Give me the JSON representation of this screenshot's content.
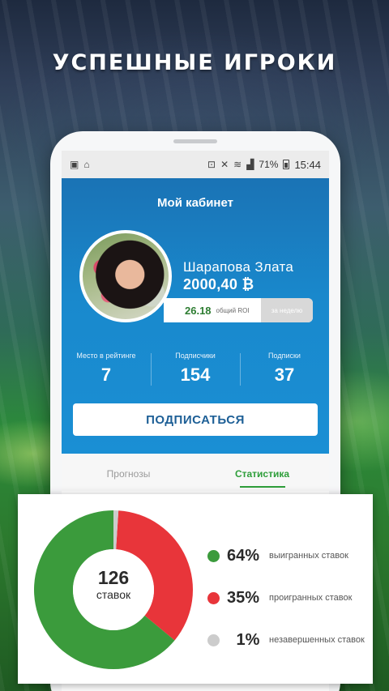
{
  "headline": "УСПЕШНЫЕ ИГРОКИ",
  "statusbar": {
    "battery": "71%",
    "time": "15:44"
  },
  "profile": {
    "cabinet_title": "Мой кабинет",
    "name": "Шарапова Злата",
    "balance": "2000,40 ₿",
    "roi_value": "26.18",
    "roi_label": "общий ROI",
    "roi_period": "за неделю"
  },
  "stats": [
    {
      "label": "Место в рейтинге",
      "value": "7"
    },
    {
      "label": "Подписчики",
      "value": "154"
    },
    {
      "label": "Подписки",
      "value": "37"
    }
  ],
  "subscribe_label": "ПОДПИСАТЬСЯ",
  "tabs": [
    {
      "label": "Прогнозы"
    },
    {
      "label": "Статистика"
    }
  ],
  "chart_data": {
    "type": "pie",
    "center_value": "126",
    "center_label": "ставок",
    "series": [
      {
        "name": "выигранных ставок",
        "percent_label": "64%",
        "value": 64,
        "color": "#3b9b3c"
      },
      {
        "name": "проигранных ставок",
        "percent_label": "35%",
        "value": 35,
        "color": "#e8353a"
      },
      {
        "name": "незавершенных ставок",
        "percent_label": "1%",
        "value": 1,
        "color": "#cccccc"
      }
    ]
  }
}
